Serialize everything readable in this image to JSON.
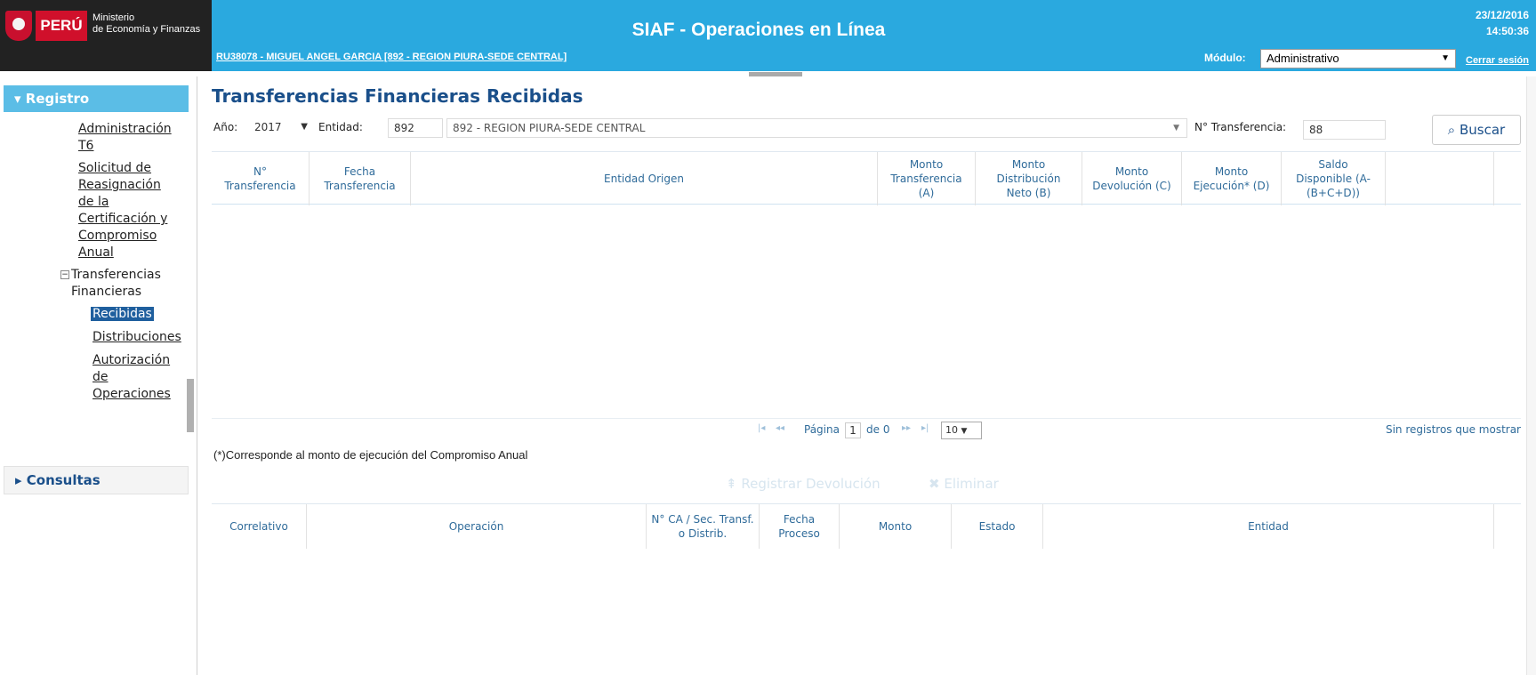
{
  "header": {
    "peru": "PERÚ",
    "ministerio": "Ministerio",
    "economia": "de Economía y Finanzas",
    "app_title": "SIAF - Operaciones en Línea",
    "user_info": "RU38078  - MIGUEL ANGEL GARCIA [892 - REGION PIURA-SEDE CENTRAL]",
    "date": "23/12/2016",
    "time": "14:50:36",
    "modulo_label": "Módulo:",
    "modulo_value": "Administrativo",
    "cerrar": "Cerrar sesión"
  },
  "sidebar": {
    "registro": "Registro",
    "items": [
      "Administración",
      "T6",
      "Solicitud de",
      "Reasignación",
      "de la",
      "Certificación y",
      "Compromiso",
      "Anual"
    ],
    "folder_line1": "Transferencias",
    "folder_line2": "Financieras",
    "recibidas": "Recibidas",
    "distribuciones": "Distribuciones",
    "autorizacion_1": "Autorización",
    "autorizacion_2": "de",
    "autorizacion_3": "Operaciones",
    "consultas": "Consultas"
  },
  "main": {
    "title": "Transferencias Financieras Recibidas",
    "anio_label": "Año:",
    "anio_value": "2017",
    "entidad_label": "Entidad:",
    "entidad_code": "892",
    "entidad_name": "892 - REGION PIURA-SEDE CENTRAL",
    "ntransf_label": "N° Transferencia:",
    "ntransf_value": "88",
    "buscar": "Buscar",
    "grid1_headers": [
      [
        "N°",
        "Transferencia"
      ],
      [
        "Fecha",
        "Transferencia"
      ],
      [
        "Entidad Origen"
      ],
      [
        "Monto",
        "Transferencia",
        "(A)"
      ],
      [
        "Monto",
        "Distribución",
        "Neto (B)"
      ],
      [
        "Monto",
        "Devolución (C)"
      ],
      [
        "Monto",
        "Ejecución* (D)"
      ],
      [
        "Saldo",
        "Disponible (A-",
        "(B+C+D))"
      ]
    ],
    "pager_pagina": "Página",
    "pager_page": "1",
    "pager_de": "de 0",
    "pager_size": "10",
    "sin_registros": "Sin registros que mostrar",
    "nota": "(*)Corresponde al monto de ejecución del Compromiso Anual",
    "registrar_devolucion": "Registrar Devolución",
    "eliminar": "Eliminar",
    "grid2_headers": [
      [
        "Correlativo"
      ],
      [
        "Operación"
      ],
      [
        "N° CA / Sec. Transf.",
        "o Distrib."
      ],
      [
        "Fecha",
        "Proceso"
      ],
      [
        "Monto"
      ],
      [
        "Estado"
      ],
      [
        "Entidad"
      ]
    ]
  }
}
